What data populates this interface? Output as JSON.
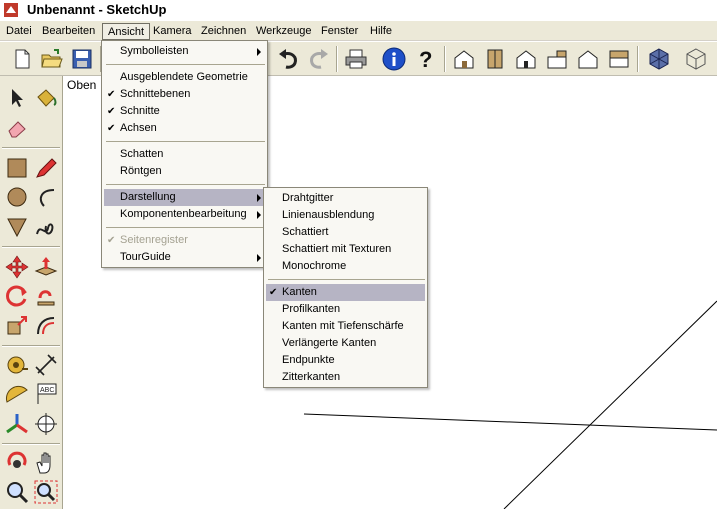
{
  "window": {
    "title": "Unbenannt - SketchUp"
  },
  "menubar": {
    "items": [
      "Datei",
      "Bearbeiten",
      "Ansicht",
      "Kamera",
      "Zeichnen",
      "Werkzeuge",
      "Fenster",
      "Hilfe"
    ],
    "active": "Ansicht"
  },
  "viewport": {
    "view_label": "Oben"
  },
  "ansicht_menu": {
    "items": [
      {
        "label": "Symbolleisten",
        "checked": false,
        "submenu": true
      },
      {
        "label": "Ausgeblendete Geometrie",
        "checked": false
      },
      {
        "label": "Schnittebenen",
        "checked": true
      },
      {
        "label": "Schnitte",
        "checked": true
      },
      {
        "label": "Achsen",
        "checked": true
      },
      {
        "label": "Schatten",
        "checked": false
      },
      {
        "label": "Röntgen",
        "checked": false
      },
      {
        "label": "Darstellung",
        "checked": false,
        "submenu": true,
        "highlighted": true
      },
      {
        "label": "Komponentenbearbeitung",
        "checked": false,
        "submenu": true
      },
      {
        "label": "Seitenregister",
        "checked": true,
        "disabled": true
      },
      {
        "label": "TourGuide",
        "checked": false,
        "submenu": true
      }
    ]
  },
  "darstellung_submenu": {
    "items": [
      {
        "label": "Drahtgitter"
      },
      {
        "label": "Linienausblendung"
      },
      {
        "label": "Schattiert"
      },
      {
        "label": "Schattiert mit Texturen"
      },
      {
        "label": "Monochrome"
      },
      {
        "label": "Kanten",
        "checked": true,
        "highlighted": true
      },
      {
        "label": "Profilkanten"
      },
      {
        "label": "Kanten mit Tiefenschärfe"
      },
      {
        "label": "Verlängerte Kanten"
      },
      {
        "label": "Endpunkte"
      },
      {
        "label": "Zitterkanten"
      }
    ]
  },
  "toolbar": {
    "icons": [
      "new-icon",
      "open-icon",
      "save-icon",
      "undo-icon",
      "redo-icon",
      "print-icon",
      "model-info-icon",
      "help-icon",
      "iso-view-icon",
      "front-view-icon",
      "right-view-icon",
      "back-view-icon",
      "left-view-icon",
      "top-view-icon",
      "xray-icon",
      "wireframe-icon"
    ]
  },
  "colors": {
    "chrome": "#ece9d8",
    "menu_bg": "#f9f8f3",
    "highlight": "#b6b4c4",
    "disabled": "#a5a292"
  },
  "left_tools": {
    "icons": [
      "select-icon",
      "paint-bucket-icon",
      "eraser-icon",
      "rectangle-icon",
      "pencil-icon",
      "circle-icon",
      "arc-icon",
      "polygon-icon",
      "freehand-icon",
      "move-icon",
      "push-pull-icon",
      "rotate-icon",
      "follow-me-icon",
      "scale-icon",
      "offset-icon",
      "tape-measure-icon",
      "dimension-icon",
      "protractor-icon",
      "text-icon",
      "axes-icon",
      "3d-text-icon",
      "orbit-icon",
      "pan-icon",
      "zoom-icon",
      "zoom-window-icon"
    ]
  }
}
